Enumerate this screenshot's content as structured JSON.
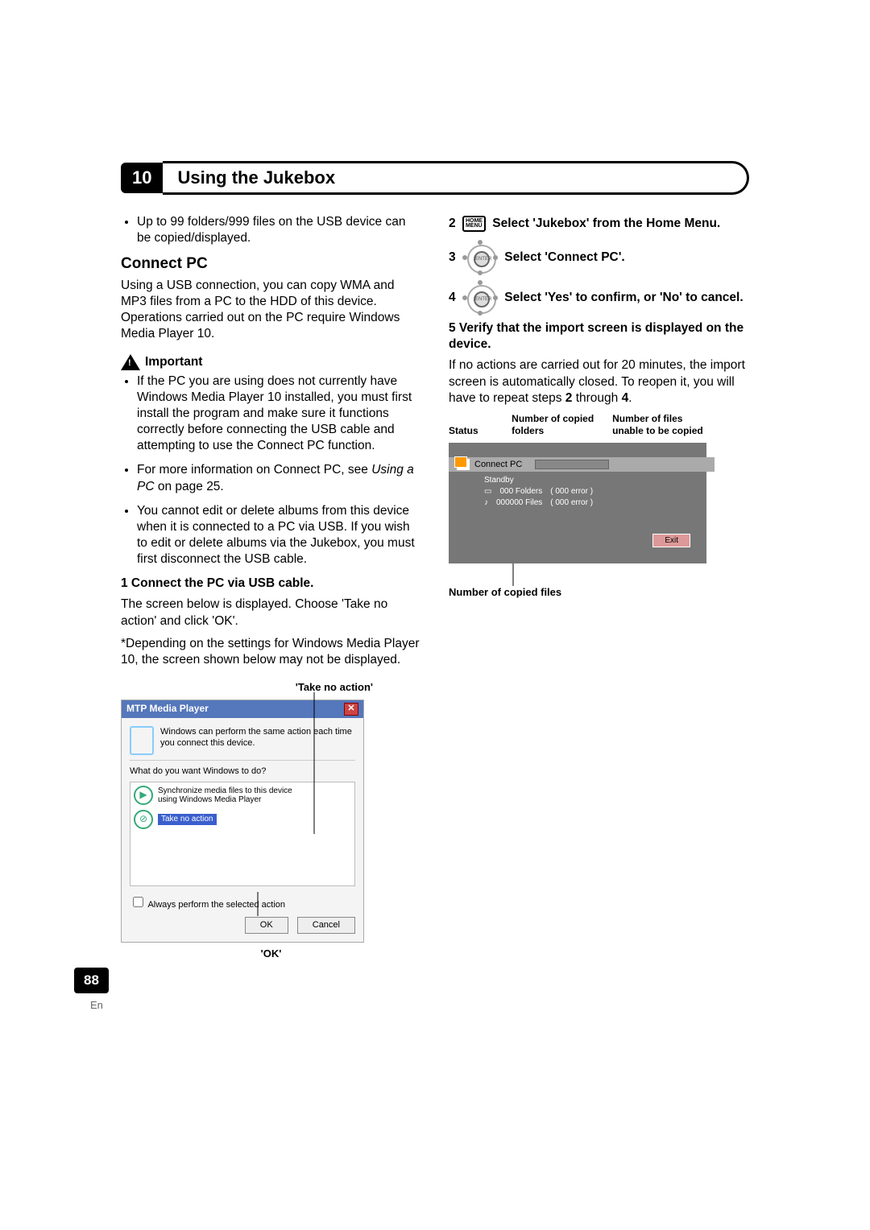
{
  "chapter": {
    "number": "10",
    "title": "Using the Jukebox"
  },
  "leftCol": {
    "copyLimit": "Up to 99 folders/999 files on the USB device can be copied/displayed.",
    "connectPCTitle": "Connect PC",
    "connectPCIntro": "Using a USB connection, you can copy WMA and MP3 files from a PC to the HDD of this device. Operations carried out on the PC require Windows Media Player 10.",
    "importantLabel": "Important",
    "bullets": [
      "If the PC you are using does not currently have Windows Media Player 10 installed, you must first install the program and make sure it functions correctly before connecting the USB cable and attempting to use the Connect PC function.",
      "For more information on Connect PC, see Using a PC on page 25.",
      "You cannot edit or delete albums from this device when it is connected to a PC via USB. If you wish to edit or delete albums via the Jukebox, you must first disconnect the USB cable."
    ],
    "step1Label": "1    Connect the PC via USB cable.",
    "step1Text": "The screen below is displayed. Choose 'Take no action' and click 'OK'.",
    "depNote": "*Depending on the settings for Windows Media Player 10, the screen shown below may not be displayed.",
    "takeNoActionCallout": "'Take no action'",
    "okCallout": "'OK'"
  },
  "dialog": {
    "title": "MTP Media Player",
    "line1": "Windows can perform the same action each time you connect this device.",
    "prompt": "What do you want Windows to do?",
    "opt1a": "Synchronize media files to this device",
    "opt1b": "using Windows Media Player",
    "opt2": "Take no action",
    "chk": "Always perform the selected action",
    "ok": "OK",
    "cancel": "Cancel"
  },
  "rightCol": {
    "step2a": "2",
    "step2b": "Select 'Jukebox' from the Home Menu.",
    "step3a": "3",
    "step3b": "Select 'Connect PC'.",
    "step4a": "4",
    "step4b": "Select 'Yes' to confirm, or 'No' to cancel.",
    "step5": "5    Verify that the import screen is displayed on the device.",
    "step5Text1": "If no actions are carried out for 20 minutes, the import screen is automatically closed. To reopen it, you will have to repeat steps ",
    "step5Bold2": "2",
    "step5Text2": " through ",
    "step5Bold4": "4",
    "step5Text3": ".",
    "hdrStatus": "Status",
    "hdrCopied": "Number of copied folders",
    "hdrUnable": "Number of files unable to be copied",
    "connectPC": "Connect PC",
    "standby": "Standby",
    "foldersLabel": "000 Folders",
    "filesLabel": "000000 Files",
    "errLabel": "( 000  error  )",
    "exit": "Exit",
    "bottomCap": "Number of copied files"
  },
  "homeMenu": {
    "l1": "HOME",
    "l2": "MENU"
  },
  "pageNum": "88",
  "lang": "En"
}
